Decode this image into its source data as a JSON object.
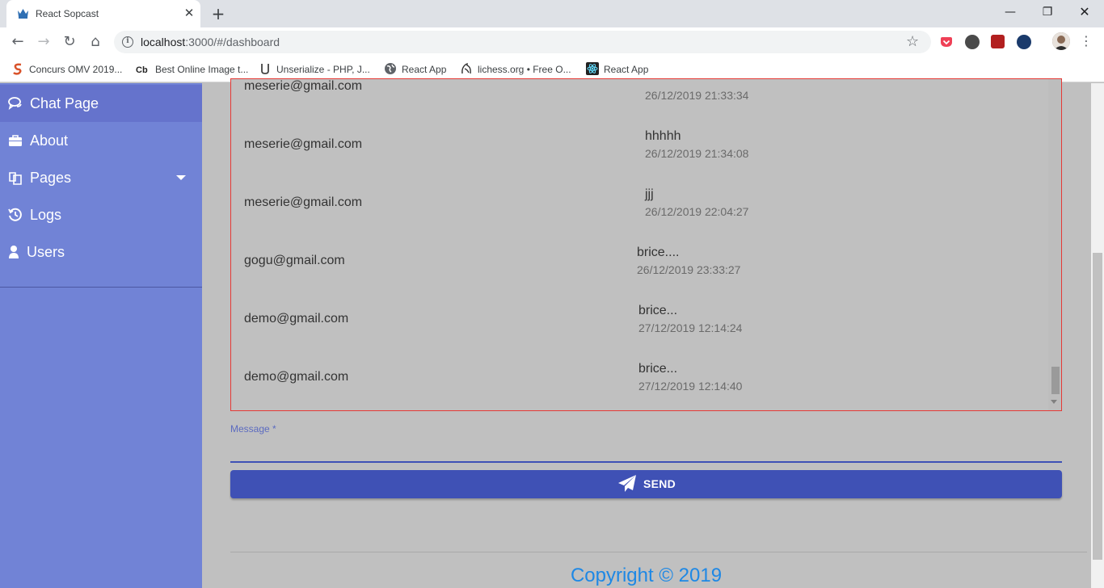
{
  "browser": {
    "tab_title": "React Sopcast",
    "url_host": "localhost",
    "url_path": ":3000/#/dashboard",
    "bookmarks": [
      {
        "label": "Concurs OMV 2019..."
      },
      {
        "label": "Best Online Image t..."
      },
      {
        "label": "Unserialize - PHP, J..."
      },
      {
        "label": "React App"
      },
      {
        "label": "lichess.org • Free O..."
      },
      {
        "label": "React App"
      }
    ]
  },
  "sidebar": {
    "items": [
      {
        "label": "Chat Page",
        "icon": "chat-icon"
      },
      {
        "label": "About",
        "icon": "briefcase-icon"
      },
      {
        "label": "Pages",
        "icon": "files-icon"
      },
      {
        "label": "Logs",
        "icon": "history-icon"
      },
      {
        "label": "Users",
        "icon": "user-icon"
      }
    ]
  },
  "messages": [
    {
      "user": "meserie@gmail.com",
      "text": "",
      "time": "26/12/2019 21:33:34"
    },
    {
      "user": "meserie@gmail.com",
      "text": "hhhhh",
      "time": "26/12/2019 21:34:08"
    },
    {
      "user": "meserie@gmail.com",
      "text": "jjj",
      "time": "26/12/2019 22:04:27"
    },
    {
      "user": "gogu@gmail.com",
      "text": "brice....",
      "time": "26/12/2019 23:33:27"
    },
    {
      "user": "demo@gmail.com",
      "text": "brice...",
      "time": "27/12/2019 12:14:24"
    },
    {
      "user": "demo@gmail.com",
      "text": "brice...",
      "time": "27/12/2019 12:14:40"
    }
  ],
  "composer": {
    "label": "Message *",
    "value": "",
    "send_label": "SEND"
  },
  "footer": {
    "copyright": "Copyright © 2019"
  },
  "colors": {
    "sidebar": "#7183d6",
    "primary": "#3f51b5",
    "border_error": "#e53935",
    "link": "#1e88e5"
  }
}
